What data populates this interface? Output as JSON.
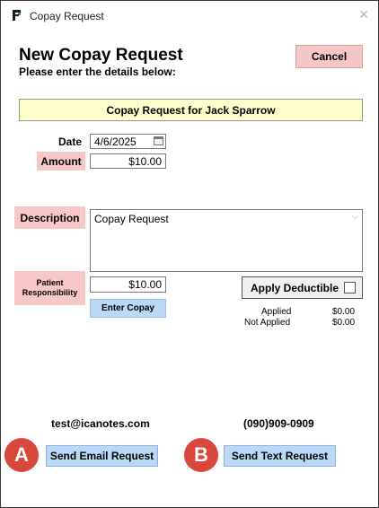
{
  "window": {
    "title": "Copay Request"
  },
  "header": {
    "heading": "New Copay Request",
    "subheading": "Please enter the details below:",
    "cancel_label": "Cancel"
  },
  "banner": {
    "text": "Copay Request for Jack Sparrow"
  },
  "form": {
    "date_label": "Date",
    "date_value": "4/6/2025",
    "amount_label": "Amount",
    "amount_value": "$10.00",
    "description_label": "Description",
    "description_value": "Copay Request",
    "patient_resp_label_line1": "Patient",
    "patient_resp_label_line2": "Responsibility",
    "patient_resp_value": "$10.00",
    "enter_copay_label": "Enter Copay",
    "apply_deductible_label": "Apply Deductible",
    "apply_deductible_checked": false
  },
  "totals": {
    "applied_label": "Applied",
    "applied_value": "$0.00",
    "not_applied_label": "Not Applied",
    "not_applied_value": "$0.00"
  },
  "contact": {
    "email": "test@icanotes.com",
    "phone": "(090)909-0909",
    "send_email_label": "Send Email Request",
    "send_text_label": "Send Text Request"
  },
  "annotations": {
    "a": "A",
    "b": "B"
  },
  "colors": {
    "pink_label": "#f8c8c8",
    "blue_button": "#b9d9f7",
    "banner_yellow": "#ffffcc",
    "badge_red": "#d9473c"
  }
}
